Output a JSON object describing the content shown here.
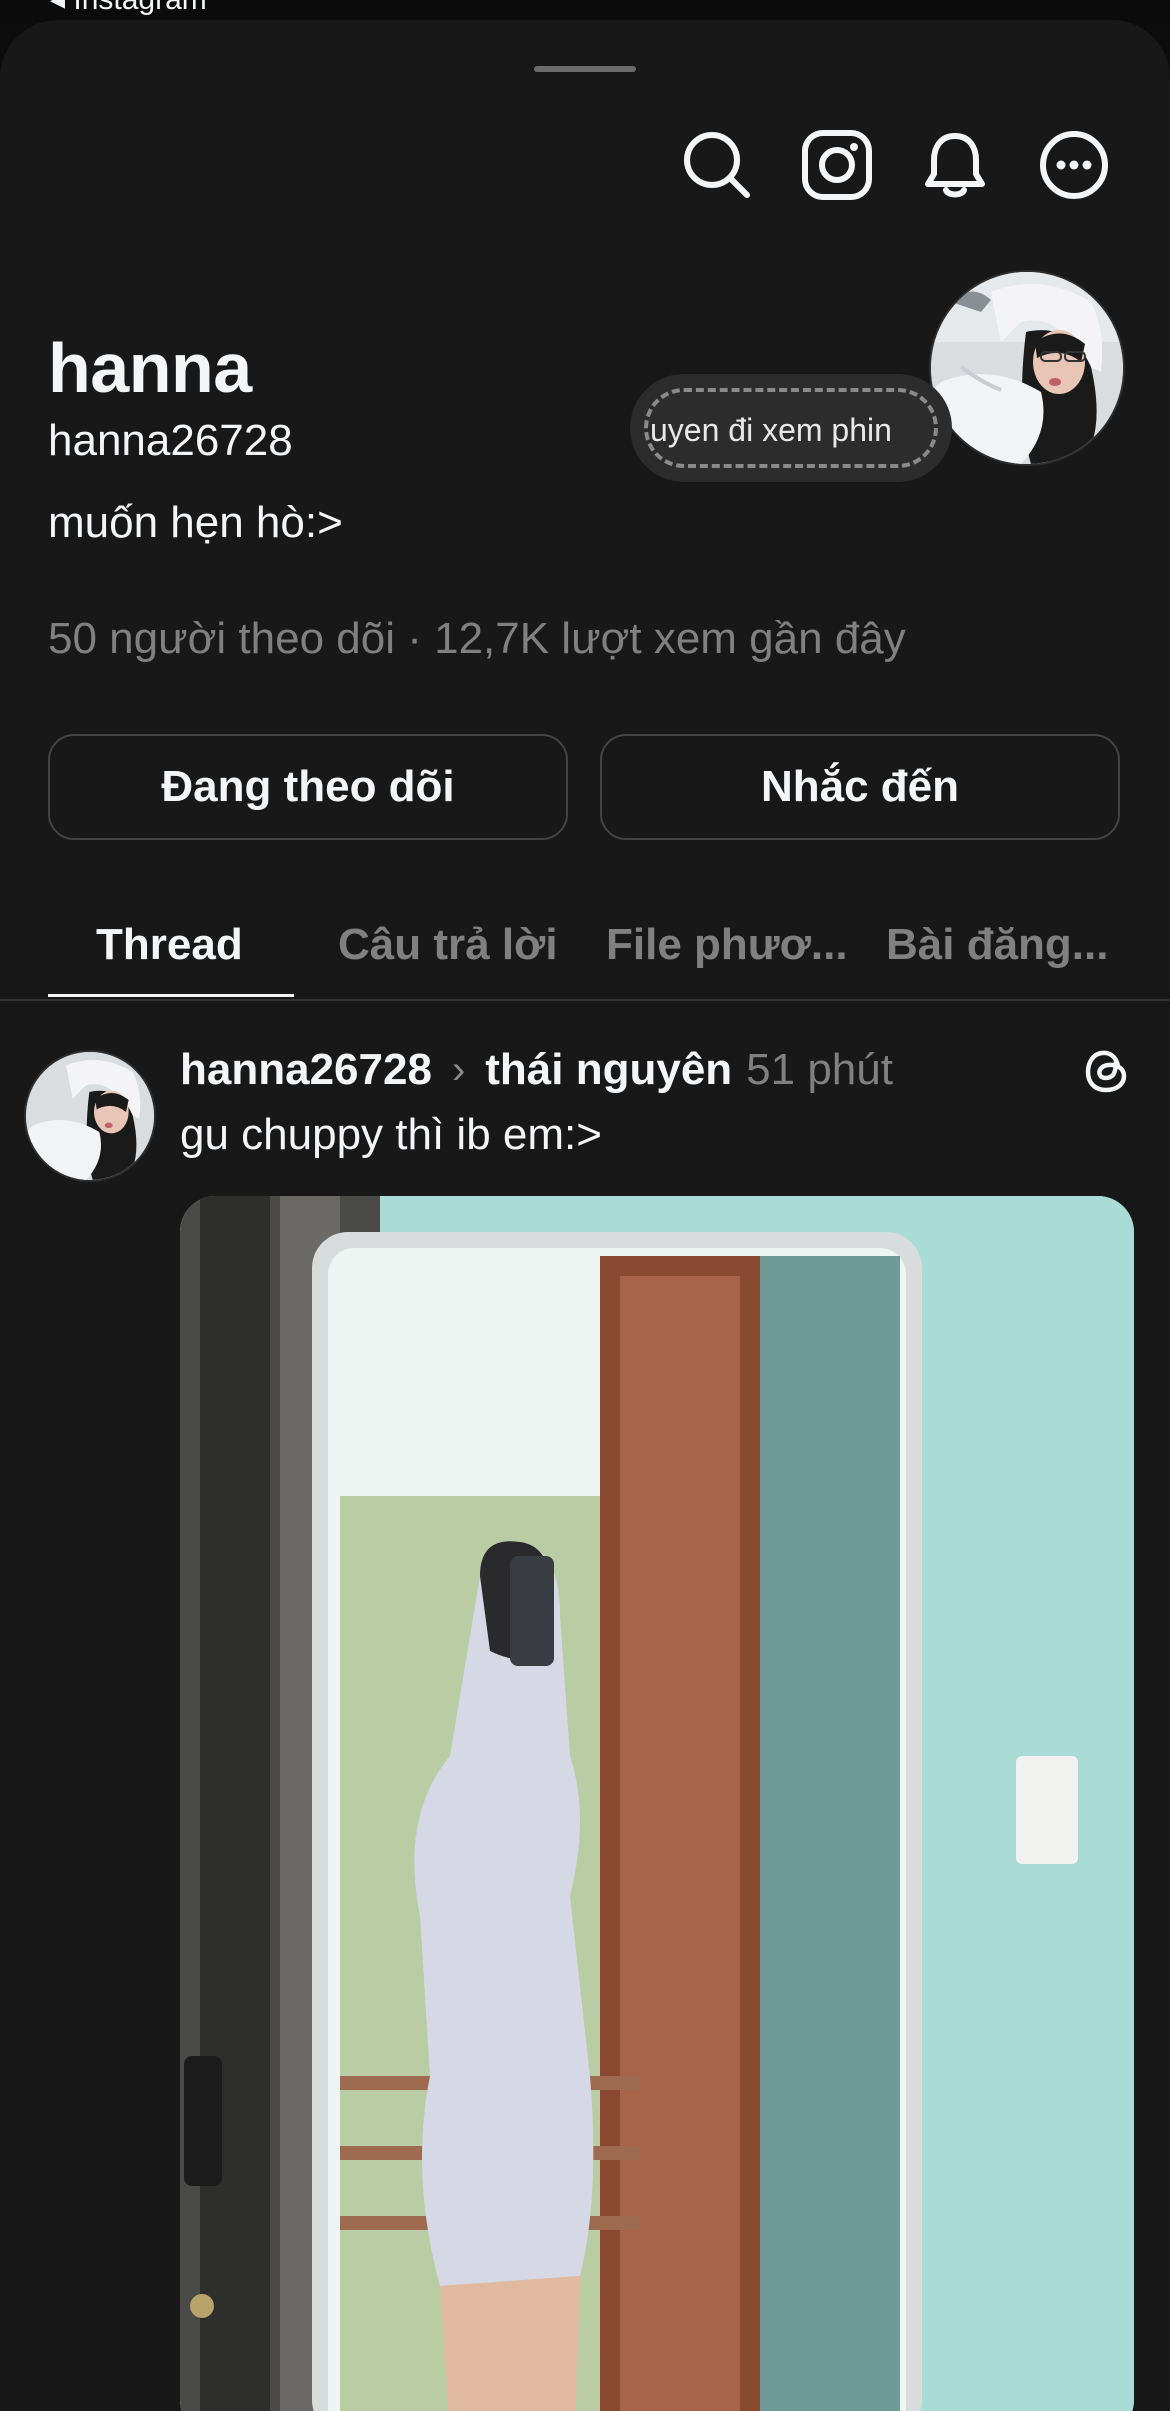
{
  "status_bar": {
    "back_app_label": "◂ Instagram"
  },
  "header_icons": [
    "search-icon",
    "instagram-icon",
    "bell-icon",
    "more-icon"
  ],
  "profile": {
    "display_name": "hanna",
    "username": "hanna26728",
    "bio": "muốn hẹn hò:>",
    "stats": "50 người theo dõi · 12,7K lượt xem gần đây",
    "note": "uyen đi xem phin"
  },
  "actions": {
    "following_label": "Đang theo dõi",
    "mention_label": "Nhắc đến"
  },
  "tabs": [
    {
      "label": "Thread",
      "active": true
    },
    {
      "label": "Câu trả lời",
      "active": false
    },
    {
      "label": "File phươ...",
      "active": false
    },
    {
      "label": "Bài đăng...",
      "active": false
    }
  ],
  "post": {
    "username": "hanna26728",
    "location": "thái nguyên",
    "time": "51 phút",
    "text": "gu chuppy thì ib em:>"
  },
  "colors": {
    "background": "#181818",
    "text_primary": "#f3f5f7",
    "text_secondary": "#808080",
    "border": "#444444"
  }
}
